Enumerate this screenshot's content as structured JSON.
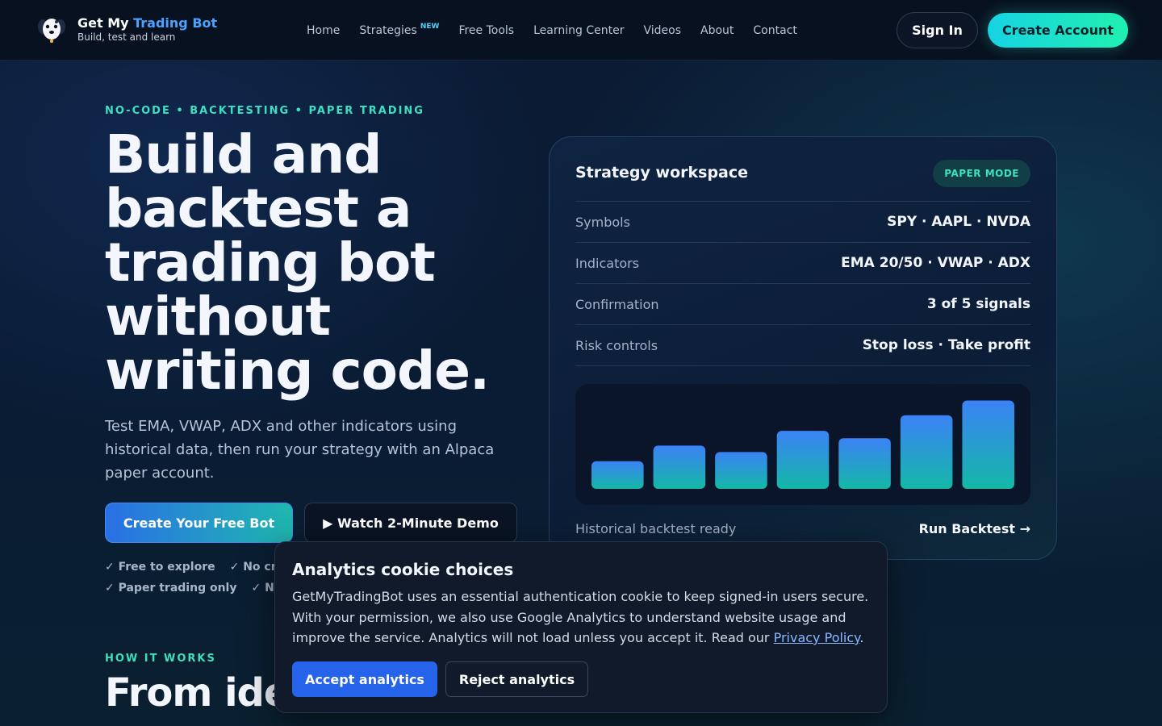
{
  "header": {
    "brand_prefix": "Get My ",
    "brand_accent": "Trading Bot",
    "tagline": "Build, test and learn",
    "nav": [
      {
        "label": "Home",
        "badge": ""
      },
      {
        "label": "Strategies",
        "badge": "NEW"
      },
      {
        "label": "Free Tools",
        "badge": ""
      },
      {
        "label": "Learning Center",
        "badge": ""
      },
      {
        "label": "Videos",
        "badge": ""
      },
      {
        "label": "About",
        "badge": ""
      },
      {
        "label": "Contact",
        "badge": ""
      }
    ],
    "sign_in": "Sign In",
    "create_account": "Create Account"
  },
  "hero": {
    "eyebrow": "NO-CODE • BACKTESTING • PAPER TRADING",
    "title": "Build and backtest a trading bot without writing code.",
    "subtitle": "Test EMA, VWAP, ADX and other indicators using historical data, then run your strategy with an Alpaca paper account.",
    "cta_primary": "Create Your Free Bot",
    "cta_secondary": "▶ Watch 2-Minute Demo",
    "checks_row1": [
      "✓ Free to explore",
      "✓ No cr"
    ],
    "checks_row2": [
      "✓ Paper trading only",
      "✓ No"
    ]
  },
  "how": {
    "eyebrow": "HOW IT WORKS",
    "title": "From ide"
  },
  "workspace": {
    "title": "Strategy workspace",
    "badge": "PAPER MODE",
    "rows": [
      {
        "label": "Symbols",
        "value": "SPY · AAPL · NVDA"
      },
      {
        "label": "Indicators",
        "value": "EMA 20/50 · VWAP · ADX"
      },
      {
        "label": "Confirmation",
        "value": "3 of 5 signals"
      },
      {
        "label": "Risk controls",
        "value": "Stop loss · Take profit"
      }
    ],
    "footer_status": "Historical backtest ready",
    "footer_action": "Run Backtest →"
  },
  "chart_data": {
    "type": "bar",
    "values": [
      30,
      47,
      40,
      63,
      55,
      80,
      96
    ],
    "ylim": [
      0,
      100
    ],
    "colors": {
      "top": "#3b82f6",
      "bottom": "#14b8a6"
    }
  },
  "cookie": {
    "title": "Analytics cookie choices",
    "body": "GetMyTradingBot uses an essential authentication cookie to keep signed-in users secure. With your permission, we also use Google Analytics to understand website usage and improve the service. Analytics will not load unless you accept it. Read our ",
    "link": "Privacy Policy",
    "end": ".",
    "accept": "Accept analytics",
    "reject": "Reject analytics"
  }
}
